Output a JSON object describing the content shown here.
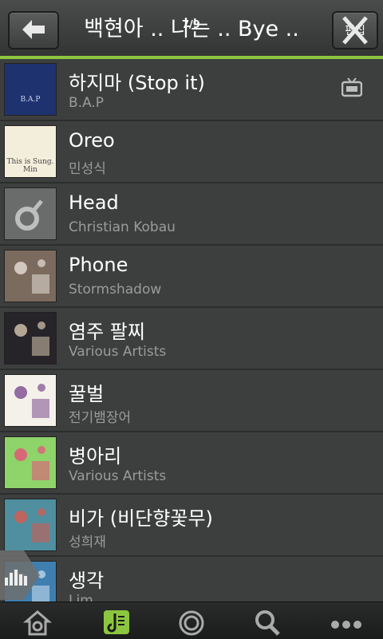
{
  "header": {
    "title": "백현아 .. 나는 .. Bye ..",
    "overlay_text": "7/9",
    "edit_label": "편집"
  },
  "songs": [
    {
      "title": "하지마 (Stop it)",
      "artist": "B.A.P",
      "thumb_bg": "#1f3270",
      "thumb_fg": "#c9d4ea",
      "thumb_text": "B.A.P",
      "has_tv": true
    },
    {
      "title": "Oreo",
      "artist": "민성식",
      "thumb_bg": "#f3eedb",
      "thumb_fg": "#444444",
      "thumb_text": "This is Sung. Min"
    },
    {
      "title": "Head",
      "artist": "Christian Kobau",
      "thumb_bg": "#6a6c6b",
      "thumb_fg": "#bdbebe",
      "thumb_text": ""
    },
    {
      "title": "Phone",
      "artist": "Stormshadow",
      "thumb_bg": "#7b6a5e",
      "thumb_fg": "#e8e0d8",
      "thumb_text": ""
    },
    {
      "title": "염주 팔찌",
      "artist": "Various Artists",
      "thumb_bg": "#262428",
      "thumb_fg": "#d8c7b0",
      "thumb_text": ""
    },
    {
      "title": "꿀벌",
      "artist": "전기뱀장어",
      "thumb_bg": "#f4f1ea",
      "thumb_fg": "#7a4b8e",
      "thumb_text": ""
    },
    {
      "title": "병아리",
      "artist": "Various Artists",
      "thumb_bg": "#8fd36b",
      "thumb_fg": "#e94f7b",
      "thumb_text": ""
    },
    {
      "title": "비가 (비단향꽃무)",
      "artist": "성희재",
      "thumb_bg": "#4f8fa0",
      "thumb_fg": "#d95a4f",
      "thumb_text": ""
    },
    {
      "title": "생각",
      "artist": "Lim",
      "thumb_bg": "#3f7fb0",
      "thumb_fg": "#cfe4f2",
      "thumb_text": ""
    }
  ],
  "colors": {
    "accent": "#8cc63f",
    "bg": "#3d3f3e",
    "subtext": "#9a9c9b"
  },
  "bottom_tabs": [
    {
      "icon": "home-icon"
    },
    {
      "icon": "music-note-icon"
    },
    {
      "icon": "headphones-icon"
    },
    {
      "icon": "search-icon"
    },
    {
      "icon": "more-icon"
    }
  ]
}
